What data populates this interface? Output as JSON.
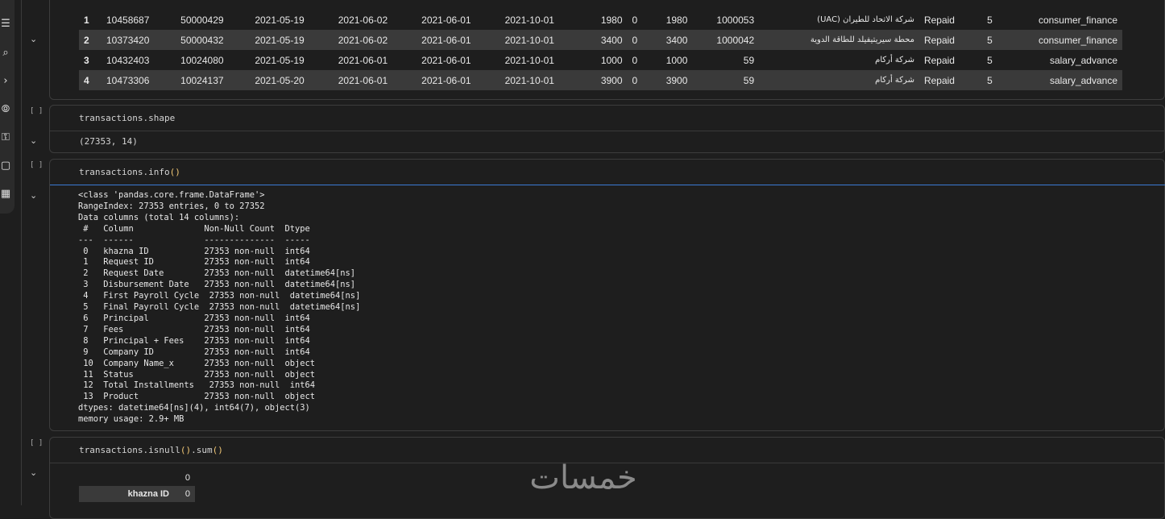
{
  "rail": {
    "icons": [
      "menu-icon",
      "search-icon",
      "code-icon",
      "variables-icon",
      "key-icon",
      "folder-icon",
      "table-icon"
    ],
    "glyphs": [
      "☰",
      "⌕",
      "›",
      "⦾",
      "⚿",
      "▢",
      "▦"
    ]
  },
  "cell_top": {
    "rows": [
      [
        "1",
        "10458687",
        "50000429",
        "2021-05-19",
        "2021-06-02",
        "2021-06-01",
        "2021-10-01",
        "1980",
        "0",
        "1980",
        "1000053",
        "شركة الاتحاد للطيران (UAC)",
        "Repaid",
        "5",
        "consumer_finance"
      ],
      [
        "2",
        "10373420",
        "50000432",
        "2021-05-19",
        "2021-06-02",
        "2021-06-01",
        "2021-10-01",
        "3400",
        "0",
        "3400",
        "1000042",
        "محطة سيريتيفيلد للطاقة الدوية",
        "Repaid",
        "5",
        "consumer_finance"
      ],
      [
        "3",
        "10432403",
        "10024080",
        "2021-05-19",
        "2021-06-01",
        "2021-06-01",
        "2021-10-01",
        "1000",
        "0",
        "1000",
        "59",
        "شركة أركام",
        "Repaid",
        "5",
        "salary_advance"
      ],
      [
        "4",
        "10473306",
        "10024137",
        "2021-05-20",
        "2021-06-01",
        "2021-06-01",
        "2021-10-01",
        "3900",
        "0",
        "3900",
        "59",
        "شركة أركام",
        "Repaid",
        "5",
        "salary_advance"
      ]
    ]
  },
  "cells": {
    "run_bracket": "[ ]",
    "shape": {
      "code": "transactions.shape",
      "output": "(27353, 14)"
    },
    "info": {
      "code_prefix": "transactions.info",
      "code_paren": "()",
      "output": "<class 'pandas.core.frame.DataFrame'>\nRangeIndex: 27353 entries, 0 to 27352\nData columns (total 14 columns):\n #   Column              Non-Null Count  Dtype\n---  ------              --------------  -----\n 0   khazna ID           27353 non-null  int64\n 1   Request ID          27353 non-null  int64\n 2   Request Date        27353 non-null  datetime64[ns]\n 3   Disbursement Date   27353 non-null  datetime64[ns]\n 4   First Payroll Cycle  27353 non-null  datetime64[ns]\n 5   Final Payroll Cycle  27353 non-null  datetime64[ns]\n 6   Principal           27353 non-null  int64\n 7   Fees                27353 non-null  int64\n 8   Principal + Fees    27353 non-null  int64\n 9   Company ID          27353 non-null  int64\n 10  Company Name_x      27353 non-null  object\n 11  Status              27353 non-null  object\n 12  Total Installments   27353 non-null  int64\n 13  Product             27353 non-null  object\ndtypes: datetime64[ns](4), int64(7), object(3)\nmemory usage: 2.9+ MB"
    },
    "isnull": {
      "code_prefix": "transactions.isnull",
      "code_paren1": "()",
      "code_mid": ".sum",
      "code_paren2": "()",
      "header": "0",
      "row_label": "khazna ID",
      "row_value": "0"
    }
  },
  "watermark": "خمسات"
}
